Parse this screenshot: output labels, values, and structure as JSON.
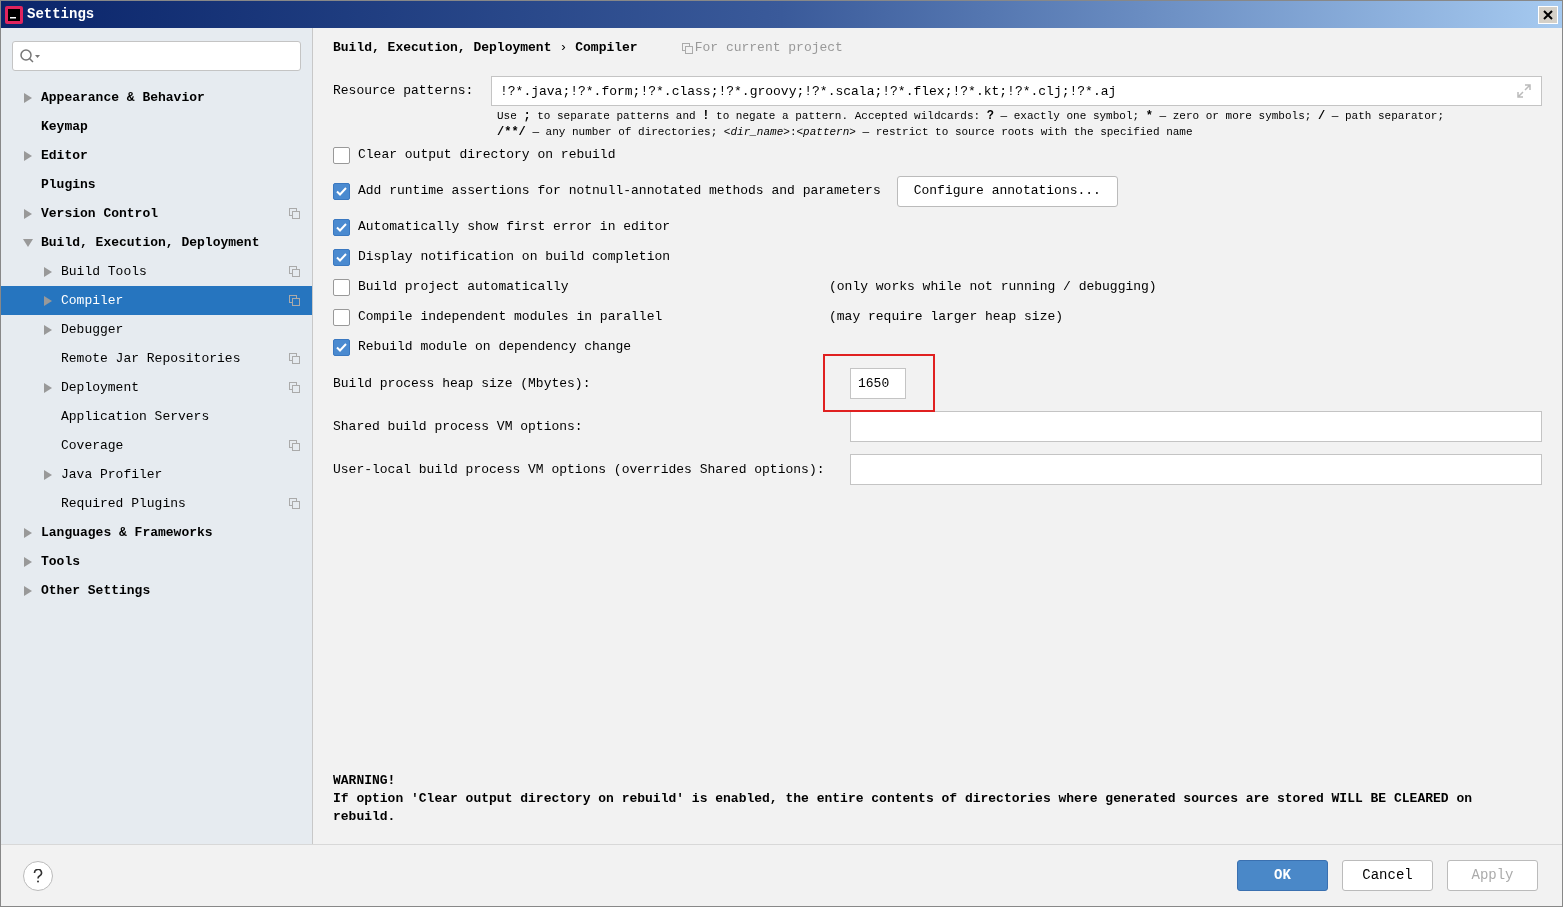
{
  "window": {
    "title": "Settings"
  },
  "sidebar": {
    "items": [
      {
        "label": "Appearance & Behavior",
        "kind": "folder",
        "expanded": false,
        "project_level": false,
        "selected": false
      },
      {
        "label": "Keymap",
        "kind": "leaf",
        "project_level": false,
        "selected": false
      },
      {
        "label": "Editor",
        "kind": "folder",
        "expanded": false,
        "project_level": false,
        "selected": false
      },
      {
        "label": "Plugins",
        "kind": "leaf",
        "project_level": false,
        "selected": false
      },
      {
        "label": "Version Control",
        "kind": "folder",
        "expanded": false,
        "project_level": true,
        "selected": false
      },
      {
        "label": "Build, Execution, Deployment",
        "kind": "folder",
        "expanded": true,
        "project_level": false,
        "selected": false,
        "children": [
          {
            "label": "Build Tools",
            "kind": "folder",
            "expanded": false,
            "project_level": true,
            "selected": false
          },
          {
            "label": "Compiler",
            "kind": "folder",
            "expanded": false,
            "project_level": true,
            "selected": true
          },
          {
            "label": "Debugger",
            "kind": "folder",
            "expanded": false,
            "project_level": false,
            "selected": false
          },
          {
            "label": "Remote Jar Repositories",
            "kind": "leaf",
            "project_level": true,
            "selected": false
          },
          {
            "label": "Deployment",
            "kind": "folder",
            "expanded": false,
            "project_level": true,
            "selected": false
          },
          {
            "label": "Application Servers",
            "kind": "leaf",
            "project_level": false,
            "selected": false
          },
          {
            "label": "Coverage",
            "kind": "leaf",
            "project_level": true,
            "selected": false
          },
          {
            "label": "Java Profiler",
            "kind": "folder",
            "expanded": false,
            "project_level": false,
            "selected": false
          },
          {
            "label": "Required Plugins",
            "kind": "leaf",
            "project_level": true,
            "selected": false
          }
        ]
      },
      {
        "label": "Languages & Frameworks",
        "kind": "folder",
        "expanded": false,
        "project_level": false,
        "selected": false
      },
      {
        "label": "Tools",
        "kind": "folder",
        "expanded": false,
        "project_level": false,
        "selected": false
      },
      {
        "label": "Other Settings",
        "kind": "folder",
        "expanded": false,
        "project_level": false,
        "selected": false
      }
    ]
  },
  "breadcrumb": {
    "path": "Build, Execution, Deployment",
    "separator": "›",
    "page": "Compiler",
    "scope": "For current project"
  },
  "resource_patterns": {
    "label": "Resource patterns:",
    "value": "!?*.java;!?*.form;!?*.class;!?*.groovy;!?*.scala;!?*.flex;!?*.kt;!?*.clj;!?*.aj",
    "hint": [
      [
        {
          "text": "Use ",
          "kind": "text"
        },
        {
          "text": ";",
          "kind": "symbol"
        },
        {
          "text": " to separate patterns and ",
          "kind": "text"
        },
        {
          "text": "!",
          "kind": "symbol"
        },
        {
          "text": " to negate a pattern. Accepted wildcards: ",
          "kind": "text"
        },
        {
          "text": "?",
          "kind": "symbol"
        },
        {
          "text": " — exactly one symbol; ",
          "kind": "text"
        },
        {
          "text": "*",
          "kind": "symbol"
        },
        {
          "text": " — zero or more symbols; ",
          "kind": "text"
        },
        {
          "text": "/",
          "kind": "symbol"
        },
        {
          "text": " — path separator;",
          "kind": "text"
        }
      ],
      [
        {
          "text": "/**/",
          "kind": "symbol"
        },
        {
          "text": " — any number of directories; ",
          "kind": "text"
        },
        {
          "text": "<dir_name>",
          "kind": "variable"
        },
        {
          "text": ":",
          "kind": "text"
        },
        {
          "text": "<pattern>",
          "kind": "variable"
        },
        {
          "text": " — restrict to source roots with the specified name",
          "kind": "text"
        }
      ]
    ]
  },
  "options": [
    {
      "label": "Clear output directory on rebuild",
      "checked": false
    },
    {
      "label": "Add runtime assertions for notnull-annotated methods and parameters",
      "checked": true,
      "button": "Configure annotations..."
    },
    {
      "label": "Automatically show first error in editor",
      "checked": true
    },
    {
      "label": "Display notification on build completion",
      "checked": true
    },
    {
      "label": "Build project automatically",
      "checked": false,
      "note": "(only works while not running / debugging)"
    },
    {
      "label": "Compile independent modules in parallel",
      "checked": false,
      "note": "(may require larger heap size)"
    },
    {
      "label": "Rebuild module on dependency change",
      "checked": true
    }
  ],
  "fields": [
    {
      "label": "Build process heap size (Mbytes):",
      "value": "1650",
      "kind": "short",
      "highlighted": true
    },
    {
      "label": "Shared build process VM options:",
      "kind": "wide",
      "highlighted": false
    },
    {
      "label": "User-local build process VM options (overrides Shared options):",
      "kind": "wide",
      "highlighted": false
    }
  ],
  "warning": {
    "title": "WARNING!",
    "text": "If option 'Clear output directory on rebuild' is enabled, the entire contents of directories where generated sources are stored WILL BE CLEARED on rebuild."
  },
  "buttons": [
    {
      "label": "OK",
      "kind": "primary",
      "disabled": false
    },
    {
      "label": "Cancel",
      "kind": "normal",
      "disabled": false
    },
    {
      "label": "Apply",
      "kind": "normal",
      "disabled": true
    }
  ]
}
